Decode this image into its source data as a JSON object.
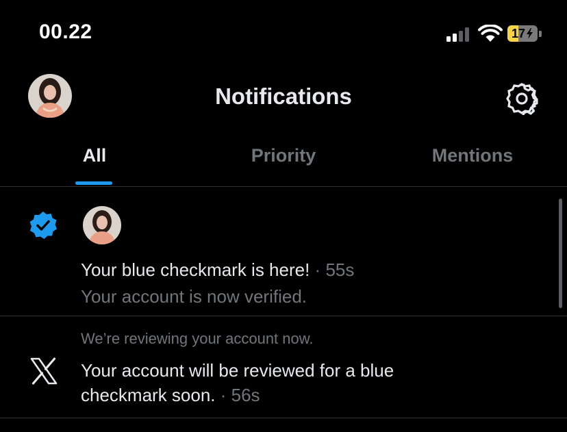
{
  "status_bar": {
    "time": "00.22",
    "battery_level": "17",
    "battery_fraction": 0.17,
    "signal_bars_active": 2,
    "signal_bars_total": 4
  },
  "header": {
    "title": "Notifications",
    "settings_icon": "gear-icon",
    "avatar": "profile-avatar"
  },
  "tabs": [
    {
      "label": "All",
      "active": true
    },
    {
      "label": "Priority",
      "active": false
    },
    {
      "label": "Mentions",
      "active": false
    }
  ],
  "notifications": [
    {
      "icon": "verified-badge-icon",
      "title": "Your blue checkmark is here!",
      "separator": " · ",
      "time": "55s",
      "subtitle": "Your account is now verified."
    },
    {
      "icon": "x-logo-icon",
      "caption": "We’re reviewing your account now.",
      "title_line1": "Your account will be reviewed for a blue",
      "title_line2": "checkmark soon.",
      "separator": " · ",
      "time": "56s"
    }
  ],
  "colors": {
    "background": "#000000",
    "text_primary": "#e7e9ea",
    "text_secondary": "#71767b",
    "accent": "#1d9bf0",
    "divider": "#2f3336",
    "battery_low": "#f5d547"
  }
}
